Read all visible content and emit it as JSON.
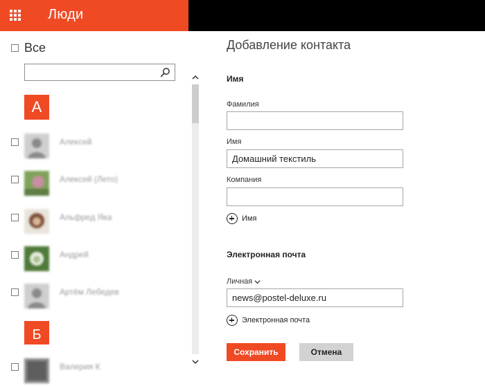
{
  "header": {
    "title": "Люди",
    "apps_icon": "apps-grid-icon",
    "colors": {
      "accent": "#f04a24",
      "bar": "#000000"
    }
  },
  "sidebar": {
    "select_all_label": "Все",
    "search": {
      "placeholder": "",
      "value": "",
      "icon": "search-icon"
    },
    "groups": [
      {
        "letter": "А"
      },
      {
        "letter": "Б"
      }
    ],
    "contacts": [
      {
        "name": "Алексей"
      },
      {
        "name": "Алексей (Лето)"
      },
      {
        "name": "Альфред Яка"
      },
      {
        "name": "Андрей"
      },
      {
        "name": "Артём Лебедев"
      },
      {
        "name": "Валерия К"
      }
    ]
  },
  "form": {
    "title": "Добавление контакта",
    "name_section": {
      "heading": "Имя",
      "last_name": {
        "label": "Фамилия",
        "value": ""
      },
      "first_name": {
        "label": "Имя",
        "value": "Домашний текстиль"
      },
      "company": {
        "label": "Компания",
        "value": ""
      },
      "add_label": "Имя"
    },
    "email_section": {
      "heading": "Электронная почта",
      "type_label": "Личная",
      "value": "news@postel-deluxe.ru",
      "add_label": "Электронная почта"
    },
    "buttons": {
      "save": "Сохранить",
      "cancel": "Отмена"
    }
  }
}
